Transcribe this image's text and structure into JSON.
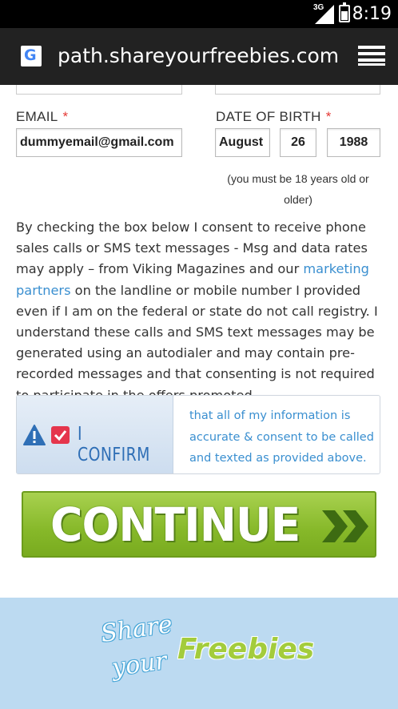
{
  "status_bar": {
    "network": "3G",
    "time": "8:19"
  },
  "browser": {
    "favicon_letter": "G",
    "url": "path.shareyourfreebies.com/?tr"
  },
  "form": {
    "email": {
      "label": "EMAIL",
      "required_mark": "*",
      "value": "dummyemail@gmail.com"
    },
    "dob": {
      "label": "DATE OF BIRTH",
      "required_mark": "*",
      "month": "August",
      "day": "26",
      "year": "1988",
      "note": "(you must be 18 years old or older)"
    }
  },
  "consent": {
    "text_before_link": "By checking the box below I consent to receive phone sales calls or SMS text messages - Msg and data rates may apply – from Viking Magazines and our ",
    "link_text": "marketing partners",
    "text_after_link": " on the landline or mobile number I provided even if I am on the federal or state do not call registry. I understand these calls and SMS text messages may be generated using an autodialer and may contain pre-recorded messages and that consenting is not required to participate in the offers promoted."
  },
  "confirm": {
    "checked": true,
    "label": "I CONFIRM",
    "text": "that all of my information is accurate & consent to be called and texted as provided above."
  },
  "continue_button": {
    "label": "CONTINUE"
  },
  "footer_logo": {
    "share": "Share",
    "your": "your",
    "freebies": "Freebies"
  },
  "colors": {
    "link": "#3a8fd0",
    "required": "#e53935",
    "checkbox": "#e5354c",
    "continue_green": "#86b829",
    "footer_bg": "#bcdaf1"
  }
}
